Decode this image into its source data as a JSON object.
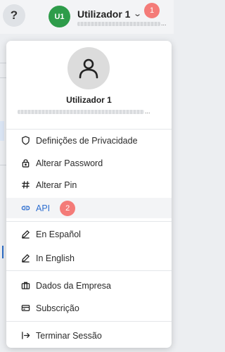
{
  "header": {
    "help_icon": "question-mark-icon",
    "help_label": "?",
    "avatar_initials": "U1",
    "user_name": "Utilizador 1",
    "email_dots": "...",
    "notification_badge": "1",
    "avatar_color": "#2e9c4a",
    "badge_color": "#f47b78"
  },
  "menu": {
    "user_name": "Utilizador 1",
    "email_dots": "...",
    "accent_color": "#2f6fd0",
    "items": [
      {
        "label": "Definições de Privacidade",
        "icon": "shield-icon"
      },
      {
        "label": "Alterar Password",
        "icon": "lock-icon"
      },
      {
        "label": "Alterar Pin",
        "icon": "hash-icon"
      },
      {
        "label": "API",
        "icon": "link-icon",
        "badge": "2"
      },
      {
        "label": "En Español",
        "icon": "pencil-icon"
      },
      {
        "label": "In English",
        "icon": "pencil-icon"
      },
      {
        "label": "Dados da Empresa",
        "icon": "briefcase-icon"
      },
      {
        "label": "Subscrição",
        "icon": "credit-card-icon"
      },
      {
        "label": "Terminar Sessão",
        "icon": "logout-icon"
      }
    ]
  }
}
